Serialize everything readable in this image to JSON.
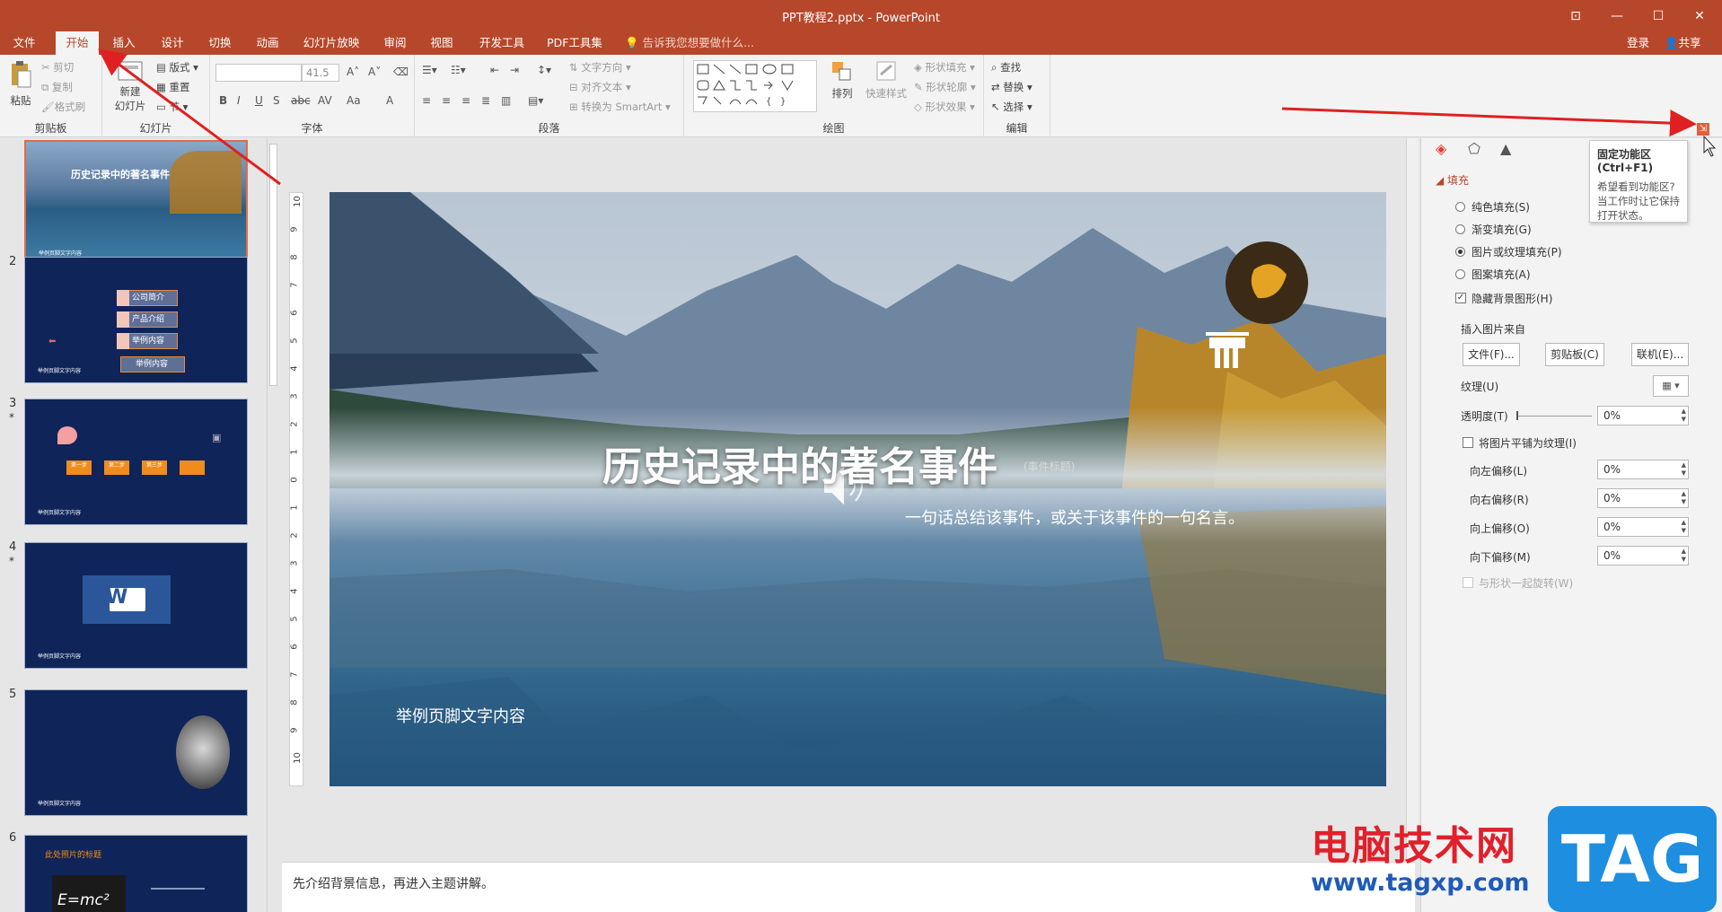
{
  "window": {
    "title": "PPT教程2.pptx - PowerPoint",
    "controls": {
      "ribbon_display": "⊡",
      "minimize": "—",
      "maximize": "☐",
      "close": "✕"
    }
  },
  "menu": {
    "tabs": [
      "文件",
      "开始",
      "插入",
      "设计",
      "切换",
      "动画",
      "幻灯片放映",
      "审阅",
      "视图",
      "开发工具",
      "PDF工具集"
    ],
    "active_tab": "开始",
    "tell_me": "告诉我您想要做什么...",
    "login": "登录",
    "share": "共享"
  },
  "ribbon": {
    "clipboard": {
      "label": "剪贴板",
      "paste": "粘贴",
      "cut": "剪切",
      "copy": "复制",
      "format_painter": "格式刷"
    },
    "slides": {
      "label": "幻灯片",
      "new_slide": "新建",
      "new_slide_2": "幻灯片",
      "layout": "版式",
      "reset": "重置",
      "section": "节"
    },
    "font": {
      "label": "字体",
      "size": "41.5",
      "bold": "B",
      "italic": "I",
      "underline": "U",
      "strike": "S",
      "abc": "abc",
      "av": "AV",
      "aa": "Aa",
      "color": "A"
    },
    "paragraph": {
      "label": "段落",
      "text_direction": "文字方向",
      "align_text": "对齐文本",
      "smartart": "转换为 SmartArt"
    },
    "drawing": {
      "label": "绘图",
      "arrange": "排列",
      "quick_styles": "快速样式",
      "shape_fill": "形状填充",
      "shape_outline": "形状轮廓",
      "shape_effects": "形状效果"
    },
    "editing": {
      "label": "编辑",
      "find": "查找",
      "replace": "替换",
      "select": "选择"
    }
  },
  "thumbnails": [
    {
      "num": "1",
      "star": "",
      "title": "历史记录中的著名事件",
      "foot": "举例页脚文字内容"
    },
    {
      "num": "2",
      "star": "",
      "items": [
        "公司简介",
        "产品介绍",
        "举例内容",
        "举例内容"
      ],
      "foot": "举例页脚文字内容"
    },
    {
      "num": "3",
      "star": "*",
      "steps": [
        "第一步",
        "第二步",
        "第三步",
        ""
      ],
      "foot": "举例页脚文字内容"
    },
    {
      "num": "4",
      "star": "*",
      "foot": "举例页脚文字内容"
    },
    {
      "num": "5",
      "star": "",
      "foot": "举例页脚文字内容"
    },
    {
      "num": "6",
      "star": "",
      "title": "此处照片的标题",
      "formula": "E=mc²"
    }
  ],
  "slide": {
    "title": "历史记录中的著名事件",
    "title_tag": "(事件标题)",
    "subtitle": "一句话总结该事件，或关于该事件的一句名言。",
    "footer": "举例页脚文字内容",
    "ruler_numbers": [
      "10",
      "9",
      "8",
      "7",
      "6",
      "5",
      "4",
      "3",
      "2",
      "1",
      "0",
      "1",
      "2",
      "3",
      "4",
      "5",
      "6",
      "7",
      "8",
      "9",
      "10"
    ]
  },
  "notes": {
    "text": "先介绍背景信息，再进入主题讲解。"
  },
  "format_pane": {
    "section": "填充",
    "options": [
      {
        "label": "纯色填充(S)",
        "selected": false
      },
      {
        "label": "渐变填充(G)",
        "selected": false
      },
      {
        "label": "图片或纹理填充(P)",
        "selected": true
      },
      {
        "label": "图案填充(A)",
        "selected": false
      }
    ],
    "hide_bg": "隐藏背景图形(H)",
    "insert_from": "插入图片来自",
    "btn_file": "文件(F)...",
    "btn_clipboard": "剪贴板(C)",
    "btn_online": "联机(E)...",
    "texture": "纹理(U)",
    "transparency": "透明度(T)",
    "transparency_value": "0%",
    "tile": "将图片平铺为纹理(I)",
    "offsets": [
      {
        "label": "向左偏移(L)",
        "value": "0%"
      },
      {
        "label": "向右偏移(R)",
        "value": "0%"
      },
      {
        "label": "向上偏移(O)",
        "value": "0%"
      },
      {
        "label": "向下偏移(M)",
        "value": "0%"
      }
    ],
    "rotate_with_shape": "与形状一起旋转(W)"
  },
  "tooltip": {
    "title": "固定功能区(Ctrl+F1)",
    "body": "希望看到功能区? 当工作时让它保持打开状态。"
  },
  "watermark": {
    "cn": "电脑技术网",
    "url": "www.tagxp.com",
    "logo": "TAG"
  },
  "colors": {
    "accent": "#b7472a",
    "slide_bg": "#0f2459",
    "annotation": "#e02020"
  }
}
